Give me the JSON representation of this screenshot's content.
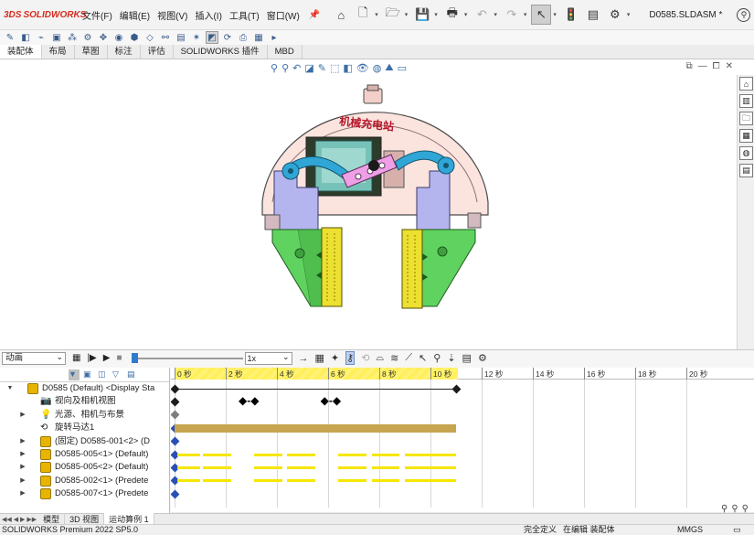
{
  "app": {
    "logo_ds": "3DS",
    "logo_text": "SOLIDWORKS",
    "document_name": "D0585.SLDASM *"
  },
  "menu": [
    "文件(F)",
    "编辑(E)",
    "视图(V)",
    "插入(I)",
    "工具(T)",
    "窗口(W)"
  ],
  "tabs": [
    "装配体",
    "布局",
    "草图",
    "标注",
    "评估",
    "SOLIDWORKS 插件",
    "MBD"
  ],
  "motion": {
    "study_type": "动画",
    "speed": "1x",
    "tree": [
      {
        "label": "D0585 (Default) <Display Sta",
        "icon": "assembly-icon",
        "expanded": true
      },
      {
        "label": "视向及相机视图",
        "icon": "camera-icon"
      },
      {
        "label": "光源、相机与布景",
        "icon": "light-icon"
      },
      {
        "label": "旋转马达1",
        "icon": "motor-icon"
      },
      {
        "label": "(固定) D0585-001<2> (D",
        "icon": "part-icon"
      },
      {
        "label": "D0585-005<1> (Default)",
        "icon": "part-icon"
      },
      {
        "label": "D0585-005<2> (Default)",
        "icon": "part-icon"
      },
      {
        "label": "D0585-002<1> (Predete",
        "icon": "part-icon"
      },
      {
        "label": "D0585-007<1> (Predete",
        "icon": "part-icon"
      }
    ],
    "ticks": [
      "0 秒",
      "2 秒",
      "4 秒",
      "6 秒",
      "8 秒",
      "10 秒",
      "12 秒",
      "14 秒",
      "16 秒",
      "18 秒",
      "20 秒"
    ]
  },
  "bottom_tabs": [
    "模型",
    "3D 视图",
    "运动算例 1"
  ],
  "status": {
    "product": "SOLIDWORKS Premium 2022 SP5.0",
    "definition": "完全定义",
    "editing": "在编辑 装配体",
    "units": "MMGS"
  },
  "model_text": "机械充电站",
  "colors": {
    "accent_blue": "#2f7ad1",
    "brand_red": "#d52b1e",
    "keyline_yellow": "#f6e600",
    "motor_bar": "#c7a550"
  }
}
